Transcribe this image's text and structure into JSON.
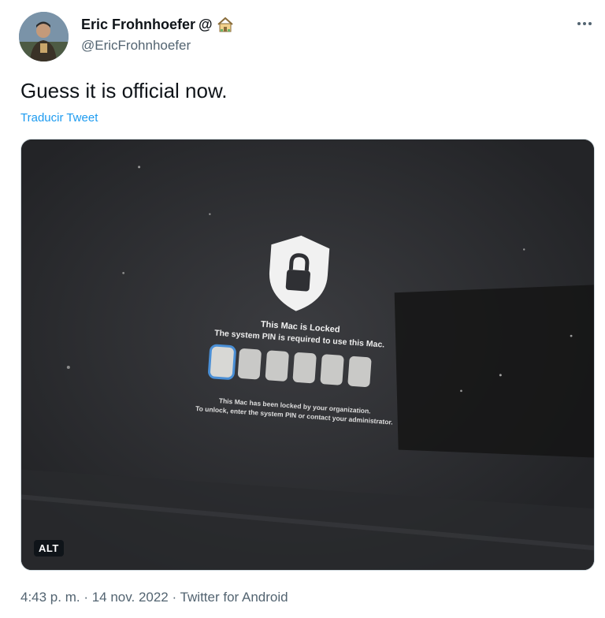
{
  "author": {
    "name": "Eric Frohnhoefer",
    "name_suffix": "@",
    "handle": "@EricFrohnhoefer",
    "badge_icon": "house-icon"
  },
  "more_icon": "more-horizontal-icon",
  "tweet": {
    "text": "Guess it is official now.",
    "translate_label": "Traducir Tweet"
  },
  "media": {
    "alt_label": "ALT",
    "lock_screen": {
      "title": "This Mac is Locked",
      "subtitle": "The system PIN is required to use this Mac.",
      "pin_length": 6,
      "note_line1": "This Mac has been locked by your organization.",
      "note_line2": "To unlock, enter the system PIN or contact your administrator."
    }
  },
  "meta": {
    "time": "4:43 p. m.",
    "separator1": " · ",
    "date": "14 nov. 2022",
    "separator2": " · ",
    "source": "Twitter for Android"
  },
  "colors": {
    "link": "#1d9bf0",
    "secondary_text": "#536471",
    "pin_focus": "#4a8fd6"
  }
}
